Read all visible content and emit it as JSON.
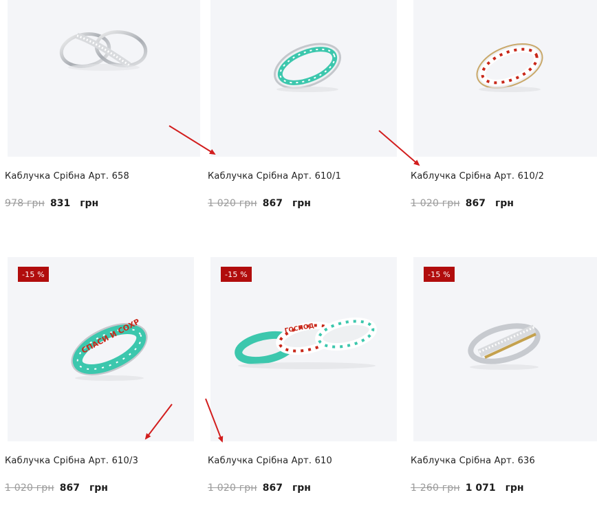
{
  "products": [
    {
      "title": "Каблучка Срібна Арт. 658",
      "old_price": "978  грн",
      "new_price": "831",
      "currency": "грн",
      "badge": "",
      "image_icon": "ring-icon"
    },
    {
      "title": "Каблучка Срібна Арт. 610/1",
      "old_price": "1 020  грн",
      "new_price": "867",
      "currency": "грн",
      "badge": "",
      "image_icon": "enamel-ring-icon"
    },
    {
      "title": "Каблучка Срібна Арт. 610/2",
      "old_price": "1 020  грн",
      "new_price": "867",
      "currency": "грн",
      "badge": "",
      "image_icon": "enamel-ring-icon"
    },
    {
      "title": "Каблучка Срібна Арт. 610/3",
      "old_price": "1 020  грн",
      "new_price": "867",
      "currency": "грн",
      "badge": "-15 %",
      "image_icon": "enamel-ring-icon"
    },
    {
      "title": "Каблучка Срібна Арт. 610",
      "old_price": "1 020  грн",
      "new_price": "867",
      "currency": "грн",
      "badge": "-15 %",
      "image_icon": "ring-set-icon"
    },
    {
      "title": "Каблучка Срібна Арт. 636",
      "old_price": "1 260  грн",
      "new_price": "1 071",
      "currency": "грн",
      "badge": "-15 %",
      "image_icon": "ring-icon"
    }
  ],
  "ring_text": {
    "red": "СПАСИ И СОХР",
    "red_alt": "ГОСПОД"
  },
  "colors": {
    "card_bg": "#f4f5f8",
    "badge_bg": "#b10d0d",
    "arrow": "#d21d1d",
    "enamel_teal": "#3cc7ad",
    "enamel_red": "#c8281a"
  }
}
